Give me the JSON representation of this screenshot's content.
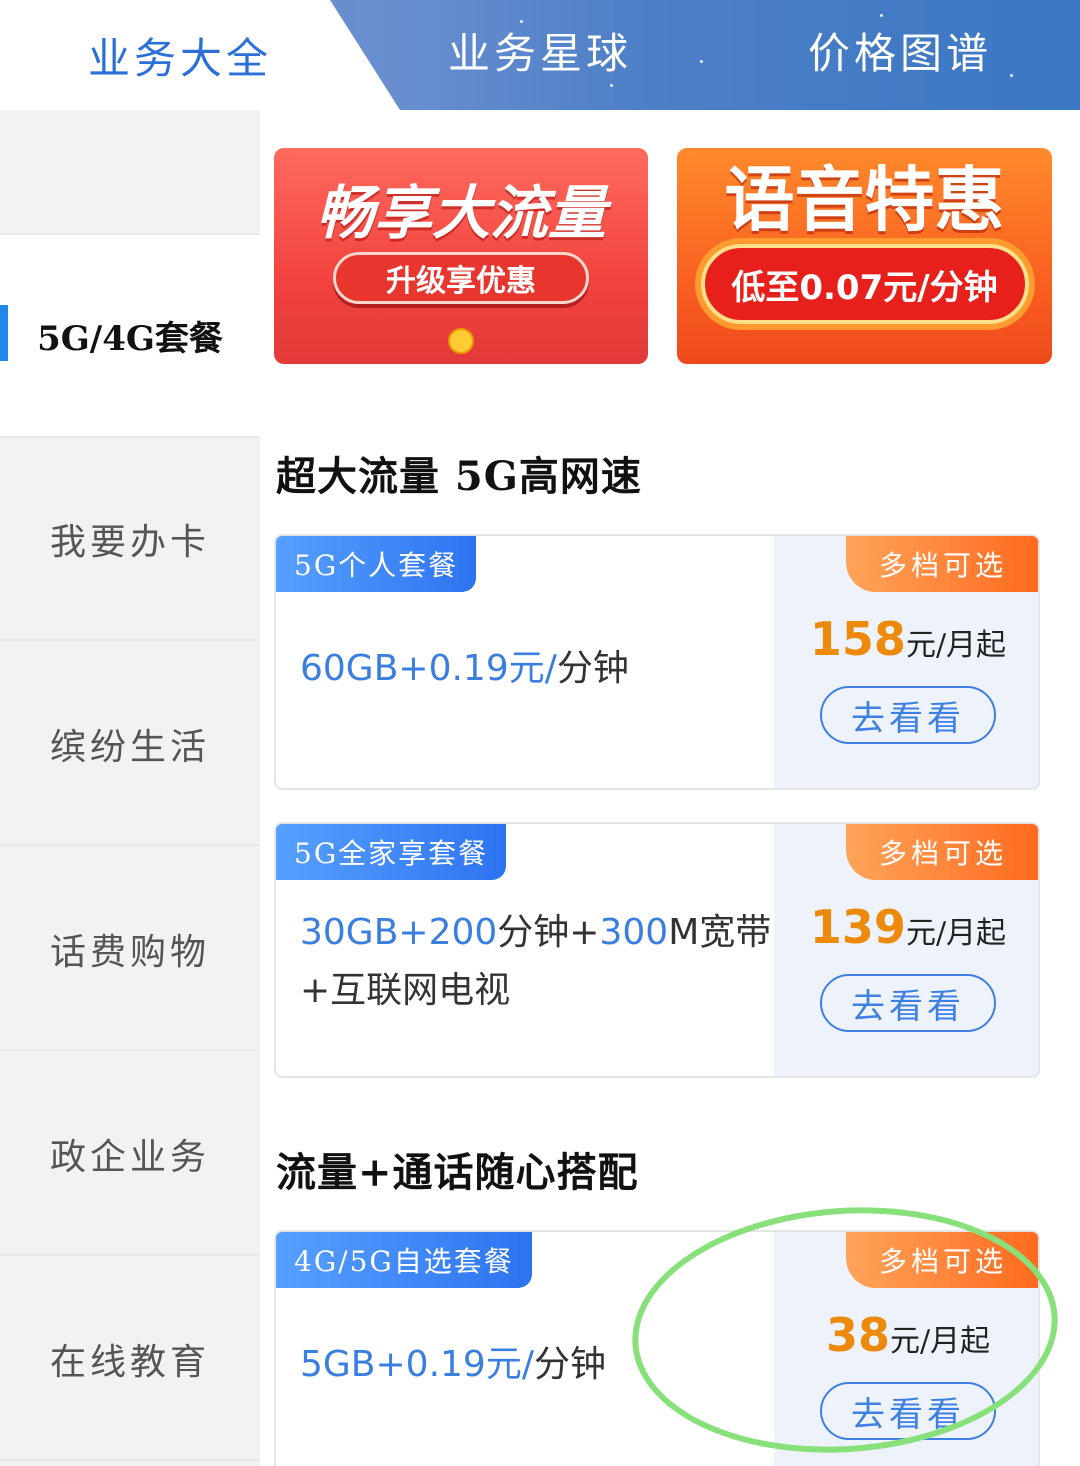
{
  "tabs": {
    "active": "业务大全",
    "middle": "业务星球",
    "right": "价格图谱"
  },
  "sidebar": {
    "items": [
      {
        "label": "5G/4G套餐"
      },
      {
        "label": "我要办卡"
      },
      {
        "label": "缤纷生活"
      },
      {
        "label": "话费购物"
      },
      {
        "label": "政企业务"
      },
      {
        "label": "在线教育"
      }
    ]
  },
  "banners": {
    "left": {
      "title": "畅享大流量",
      "button": "升级享优惠"
    },
    "right": {
      "title": "语音特惠",
      "button": "低至0.07元/分钟"
    }
  },
  "sections": [
    {
      "title": "超大流量 5G高网速"
    },
    {
      "title": "流量+通话随心搭配"
    }
  ],
  "cards": [
    {
      "tag": "5G个人套餐",
      "ribbon": "多档可选",
      "desc_parts": [
        "60GB+",
        "0.19元/",
        "分钟"
      ],
      "price": "158",
      "unit": "元/月起",
      "button": "去看看"
    },
    {
      "tag": "5G全家享套餐",
      "ribbon": "多档可选",
      "desc_parts": [
        "30GB+",
        "200",
        "分钟+",
        "300",
        "M宽带",
        "+互联网电视"
      ],
      "price": "139",
      "unit": "元/月起",
      "button": "去看看"
    },
    {
      "tag": "4G/5G自选套餐",
      "ribbon": "多档可选",
      "desc_parts": [
        "5GB+",
        "0.19元/",
        "分钟"
      ],
      "price": "38",
      "unit": "元/月起",
      "button": "去看看"
    }
  ],
  "colors": {
    "accent_blue": "#2c6fd6",
    "price_orange": "#ee8a0b",
    "annotation_green": "#88e07a"
  }
}
